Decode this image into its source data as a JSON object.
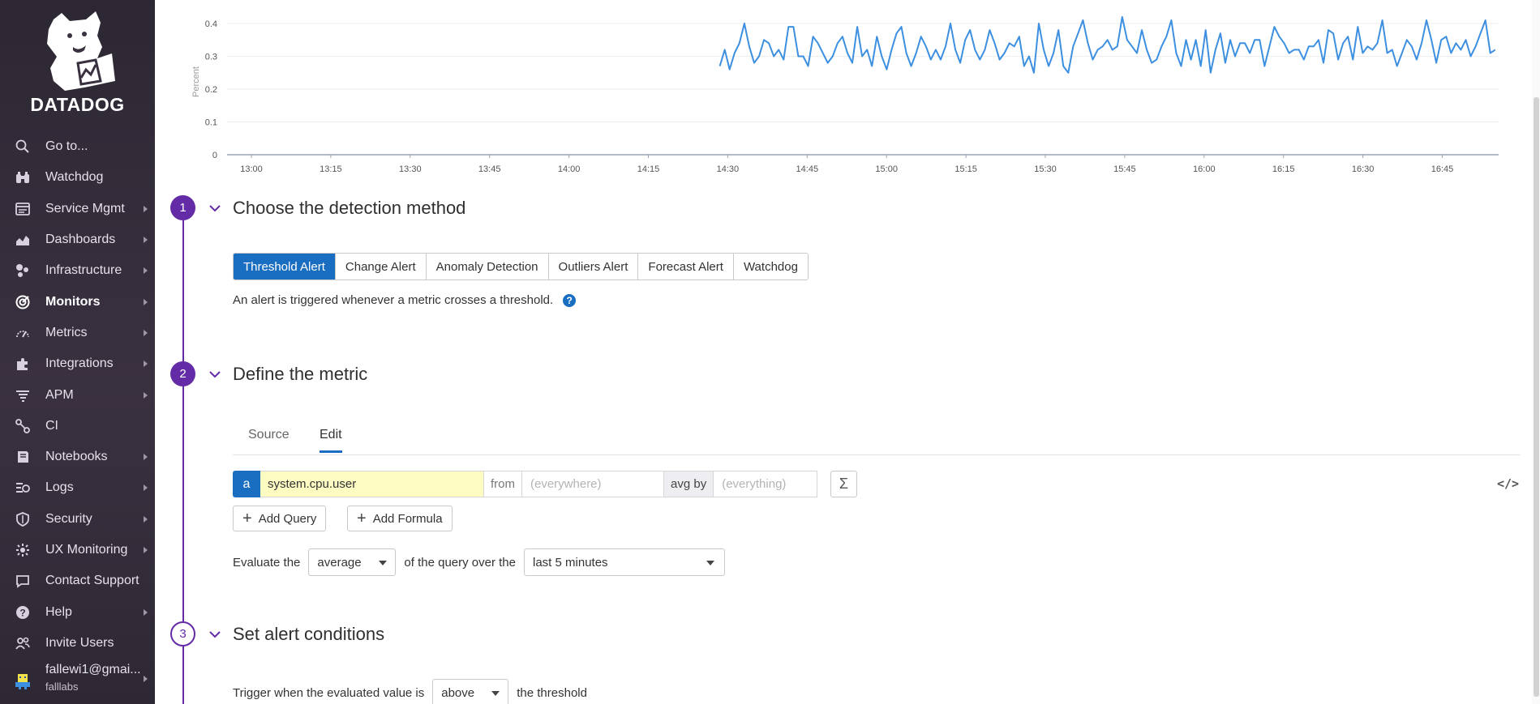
{
  "sidebar": {
    "brand": "DATADOG",
    "items": [
      {
        "label": "Go to...",
        "icon": "search-icon",
        "arrow": false,
        "active": false
      },
      {
        "label": "Watchdog",
        "icon": "binoculars-icon",
        "arrow": false,
        "active": false
      },
      {
        "label": "Service Mgmt",
        "icon": "service-icon",
        "arrow": true,
        "active": false
      },
      {
        "label": "Dashboards",
        "icon": "dashboard-icon",
        "arrow": true,
        "active": false
      },
      {
        "label": "Infrastructure",
        "icon": "infrastructure-icon",
        "arrow": true,
        "active": false
      },
      {
        "label": "Monitors",
        "icon": "monitor-icon",
        "arrow": true,
        "active": true
      },
      {
        "label": "Metrics",
        "icon": "metrics-icon",
        "arrow": true,
        "active": false
      },
      {
        "label": "Integrations",
        "icon": "puzzle-icon",
        "arrow": true,
        "active": false
      },
      {
        "label": "APM",
        "icon": "apm-icon",
        "arrow": true,
        "active": false
      },
      {
        "label": "CI",
        "icon": "ci-icon",
        "arrow": false,
        "active": false
      },
      {
        "label": "Notebooks",
        "icon": "notebook-icon",
        "arrow": true,
        "active": false
      },
      {
        "label": "Logs",
        "icon": "logs-icon",
        "arrow": true,
        "active": false
      },
      {
        "label": "Security",
        "icon": "shield-icon",
        "arrow": true,
        "active": false
      },
      {
        "label": "UX Monitoring",
        "icon": "ux-icon",
        "arrow": true,
        "active": false
      },
      {
        "label": "Contact Support",
        "icon": "chat-icon",
        "arrow": false,
        "active": false
      },
      {
        "label": "Help",
        "icon": "help-icon",
        "arrow": true,
        "active": false
      },
      {
        "label": "Invite Users",
        "icon": "users-icon",
        "arrow": false,
        "active": false
      }
    ],
    "user": {
      "email": "fallewi1@gmai...",
      "org": "falllabs"
    }
  },
  "chart_data": {
    "type": "line",
    "ylabel": "Percent",
    "ylim": [
      0,
      0.4
    ],
    "yticks": [
      "0",
      "0.1",
      "0.2",
      "0.3",
      "0.4"
    ],
    "xticks": [
      "13:00",
      "13:15",
      "13:30",
      "13:45",
      "14:00",
      "14:15",
      "14:30",
      "14:45",
      "15:00",
      "15:15",
      "15:30",
      "15:45",
      "16:00",
      "16:15",
      "16:30",
      "16:45"
    ],
    "x_start_minutes": 0,
    "x_end_minutes": 235,
    "series_start_minutes": 88.5,
    "color": "#3d8fe0",
    "values": [
      0.27,
      0.32,
      0.26,
      0.31,
      0.34,
      0.4,
      0.33,
      0.28,
      0.3,
      0.35,
      0.34,
      0.3,
      0.32,
      0.29,
      0.39,
      0.39,
      0.3,
      0.3,
      0.27,
      0.36,
      0.34,
      0.31,
      0.28,
      0.3,
      0.34,
      0.36,
      0.31,
      0.28,
      0.39,
      0.3,
      0.32,
      0.27,
      0.36,
      0.3,
      0.26,
      0.32,
      0.37,
      0.39,
      0.31,
      0.27,
      0.31,
      0.36,
      0.33,
      0.29,
      0.32,
      0.29,
      0.33,
      0.4,
      0.32,
      0.28,
      0.35,
      0.38,
      0.32,
      0.29,
      0.32,
      0.38,
      0.34,
      0.29,
      0.31,
      0.34,
      0.33,
      0.36,
      0.27,
      0.3,
      0.25,
      0.4,
      0.32,
      0.27,
      0.31,
      0.38,
      0.27,
      0.25,
      0.33,
      0.37,
      0.41,
      0.34,
      0.29,
      0.32,
      0.33,
      0.35,
      0.32,
      0.33,
      0.42,
      0.35,
      0.33,
      0.31,
      0.38,
      0.32,
      0.28,
      0.29,
      0.33,
      0.36,
      0.41,
      0.31,
      0.27,
      0.35,
      0.29,
      0.35,
      0.27,
      0.38,
      0.25,
      0.32,
      0.37,
      0.28,
      0.35,
      0.3,
      0.34,
      0.34,
      0.31,
      0.35,
      0.35,
      0.27,
      0.33,
      0.39,
      0.36,
      0.34,
      0.31,
      0.32,
      0.32,
      0.29,
      0.33,
      0.33,
      0.35,
      0.28,
      0.38,
      0.37,
      0.29,
      0.34,
      0.36,
      0.29,
      0.39,
      0.31,
      0.33,
      0.32,
      0.34,
      0.41,
      0.31,
      0.32,
      0.27,
      0.31,
      0.35,
      0.33,
      0.29,
      0.34,
      0.41,
      0.35,
      0.28,
      0.35,
      0.36,
      0.31,
      0.34,
      0.32,
      0.35,
      0.3,
      0.33,
      0.37,
      0.41,
      0.31,
      0.32
    ]
  },
  "steps": {
    "s1": {
      "num": "1",
      "title": "Choose the detection method"
    },
    "s2": {
      "num": "2",
      "title": "Define the metric"
    },
    "s3": {
      "num": "3",
      "title": "Set alert conditions"
    }
  },
  "detection": {
    "options": [
      "Threshold Alert",
      "Change Alert",
      "Anomaly Detection",
      "Outliers Alert",
      "Forecast Alert",
      "Watchdog"
    ],
    "active_index": 0,
    "description": "An alert is triggered whenever a metric crosses a threshold.",
    "help": "?"
  },
  "metric": {
    "tabs": {
      "source": "Source",
      "edit": "Edit"
    },
    "query": {
      "letter": "a",
      "name": "system.cpu.user",
      "from_label": "from",
      "from_placeholder": "(everywhere)",
      "avgby_label": "avg by",
      "avgby_placeholder": "(everything)",
      "sigma": "Σ",
      "code": "</>"
    },
    "add_query": "Add Query",
    "add_formula": "Add Formula",
    "eval": {
      "prefix": "Evaluate the",
      "aggregation": "average",
      "middle": "of the query over the",
      "window": "last 5 minutes"
    }
  },
  "conditions": {
    "prefix": "Trigger when the evaluated value is",
    "comparator": "above",
    "suffix": "the threshold"
  }
}
